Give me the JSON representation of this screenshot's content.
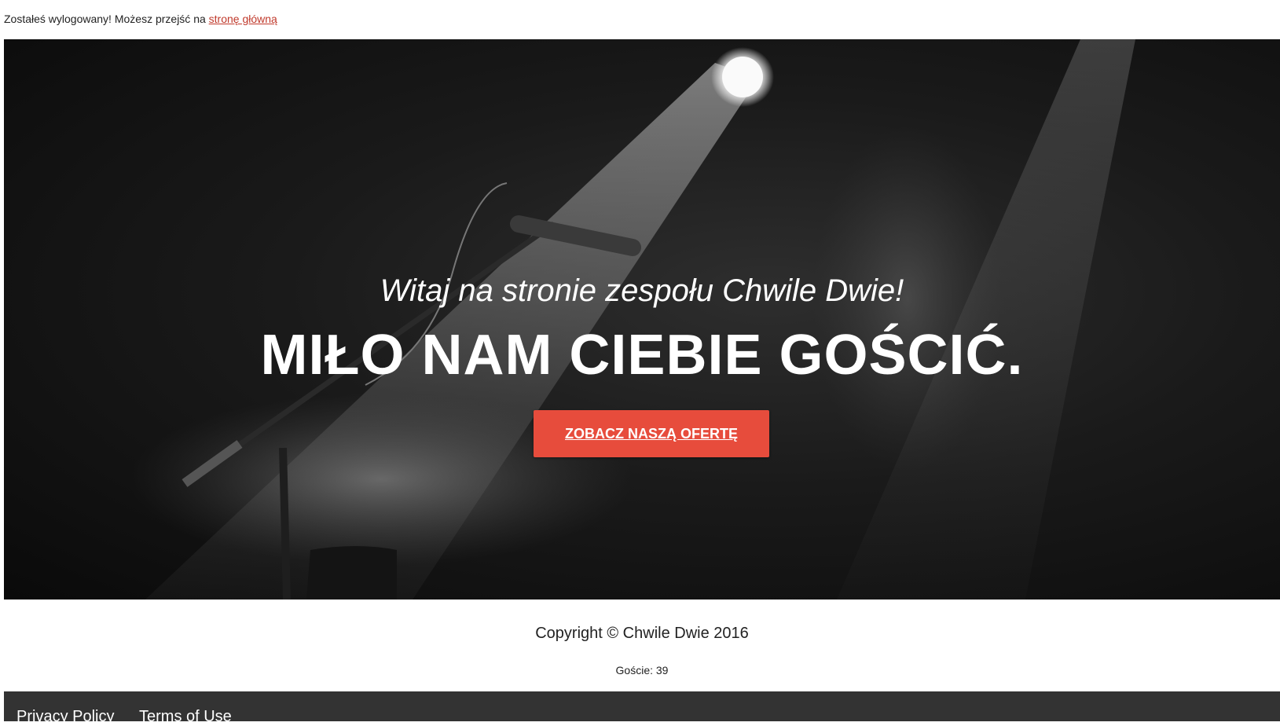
{
  "logout_message": {
    "text": "Zostałeś wylogowany! Możesz przejść na ",
    "link_label": "stronę główną"
  },
  "hero": {
    "welcome": "Witaj na stronie zespołu Chwile Dwie!",
    "headline": "MIŁO NAM CIEBIE GOŚCIĆ.",
    "cta_label": "ZOBACZ NASZĄ OFERTĘ"
  },
  "footer": {
    "copyright": "Copyright © Chwile Dwie 2016",
    "guests": "Goście: 39",
    "links": [
      "Privacy Policy",
      "Terms of Use"
    ]
  }
}
